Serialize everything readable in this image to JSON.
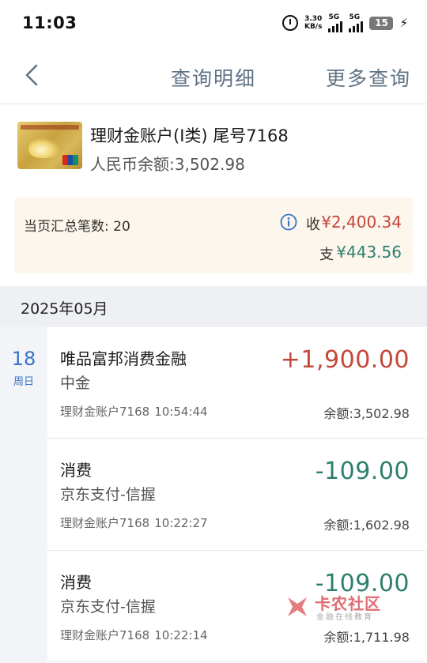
{
  "status_bar": {
    "time": "11:03",
    "net_speed_value": "3.30",
    "net_speed_unit": "KB/s",
    "sim1_label": "5G",
    "sim2_label": "5G",
    "battery_level": "15",
    "icons": [
      "alarm-icon",
      "signal-icon",
      "charging-bolt-icon"
    ]
  },
  "nav": {
    "title": "查询明细",
    "more_query": "更多查询",
    "back_icon": "chevron-left-icon"
  },
  "account": {
    "name": "理财金账户(Ⅰ类) 尾号7168",
    "balance": "人民币余额:3,502.98"
  },
  "summary": {
    "count_text": "当页汇总笔数: 20",
    "income_label": "收",
    "income_value": "¥2,400.34",
    "expense_label": "支",
    "expense_value": "¥443.56"
  },
  "month": "2025年05月",
  "date": {
    "day": "18",
    "weekday": "周日"
  },
  "transactions": [
    {
      "title": "唯品富邦消费金融",
      "counterparty": "中金",
      "account": "理财金账户7168",
      "time": "10:54:44",
      "amount": "+1,900.00",
      "balance": "余额:3,502.98"
    },
    {
      "title": "消费",
      "counterparty": "京东支付-信握",
      "account": "理财金账户7168",
      "time": "10:22:27",
      "amount": "-109.00",
      "balance": "余额:1,602.98"
    },
    {
      "title": "消费",
      "counterparty": "京东支付-信握",
      "account": "理财金账户7168",
      "time": "10:22:14",
      "amount": "-109.00",
      "balance": "余额:1,711.98"
    }
  ],
  "watermark": {
    "title": "卡农社区",
    "subtitle": "金融在线教育"
  },
  "colors": {
    "income": "#c4473a",
    "expense": "#2f7f6f",
    "nav_text": "#5f7285",
    "date_blue": "#3a73c6"
  }
}
